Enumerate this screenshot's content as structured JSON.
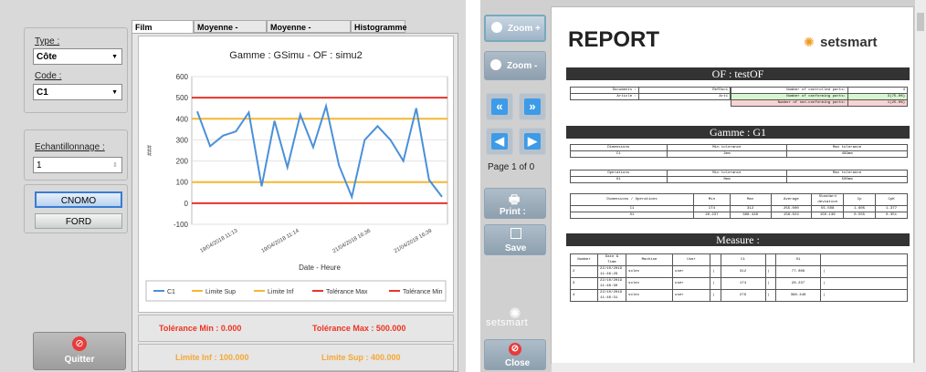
{
  "left": {
    "type_label": "Type :",
    "type_value": "Côte",
    "code_label": "Code :",
    "code_value": "C1",
    "sampling_label": "Echantillonnage :",
    "sampling_value": "1",
    "cnomo_button": "CNOMO",
    "ford_button": "FORD",
    "quit_button": "Quitter",
    "tabs": [
      "Film production",
      "Moyenne - Etendue",
      "Moyenne - EcartType",
      "Histogramme"
    ],
    "tol_min": "Tolérance Min :  0.000",
    "tol_max": "Tolérance Max :  500.000",
    "lim_inf": "Limite Inf :  100.000",
    "lim_sup": "Limite Sup :  400.000"
  },
  "chart_data": {
    "type": "line",
    "title": "Gamme : GSimu - OF : simu2",
    "xlabel": "Date - Heure",
    "ylabel": "###",
    "ylim": [
      -100,
      600
    ],
    "yticks": [
      -100,
      0,
      100,
      200,
      300,
      400,
      500,
      600
    ],
    "xtick_labels": [
      "19/04/2018 11:13",
      "19/04/2018 11:14",
      "21/04/2018 16:36",
      "21/04/2018 16:39"
    ],
    "series": [
      {
        "name": "C1",
        "color": "#4a90d9",
        "values": [
          435,
          270,
          320,
          340,
          430,
          80,
          390,
          170,
          420,
          265,
          460,
          180,
          30,
          300,
          365,
          300,
          200,
          450,
          110,
          30
        ]
      },
      {
        "name": "Limite Sup",
        "color": "#f6b630",
        "constant": 400
      },
      {
        "name": "Limite Inf",
        "color": "#f6b630",
        "constant": 100
      },
      {
        "name": "Tolérance Max",
        "color": "#e8332a",
        "constant": 500
      },
      {
        "name": "Tolérance Min",
        "color": "#e8332a",
        "constant": 0
      }
    ],
    "legend": "bottom",
    "grid": true
  },
  "right": {
    "zoom_in": "Zoom +",
    "zoom_out": "Zoom -",
    "page_info": "Page 1 of 0",
    "print_button": "Print :",
    "save_button": "Save",
    "close_button": "Close",
    "brand": "setsmart"
  },
  "report": {
    "title": "REPORT",
    "brand": "setsmart",
    "of_bar": "OF : testOF",
    "documents_label": "Documents :",
    "documents_value": "RefDoc1",
    "article_label": "Article :",
    "article_value": "Art1",
    "controlled_label": "Number of controlled parts:",
    "controlled_value": "4",
    "conforming_label": "Number of conforming parts:",
    "conforming_value": "3(75.0%)",
    "nonconforming_label": "Number of non-conforming parts:",
    "nonconforming_value": "1(25.0%)",
    "gamme_bar": "Gamme : G1",
    "dims_header": [
      "Dimensions",
      "Min tolerance",
      "Max tolerance"
    ],
    "dims_row": [
      "C1",
      "2mm",
      "499mm"
    ],
    "ops_header": [
      "Operations",
      "Min tolerance",
      "Max tolerance"
    ],
    "ops_row": [
      "O1",
      "0mm",
      "500mm"
    ],
    "stats_header": [
      "Dimensions / Operations",
      "Min",
      "Max",
      "Average",
      "Standard deviation",
      "Cp",
      "CpK"
    ],
    "stats_rows": [
      [
        "C1",
        "174",
        "312",
        "255.000",
        "55.508",
        "1.605",
        "1.377"
      ],
      [
        "O1",
        "28.237",
        "368.448",
        "158.024",
        "150.136",
        "0.555",
        "0.351"
      ]
    ],
    "measure_bar": "Measure :",
    "measure_header": [
      "Number",
      "Date & Time",
      "Machine",
      "User",
      "",
      "C1",
      "",
      "O1",
      ""
    ],
    "measure_rows": [
      [
        "2",
        "22/10/2019 11:46:29",
        "solex",
        "user",
        "|",
        "312",
        "|",
        "77.086",
        "|"
      ],
      [
        "3",
        "22/10/2019 11:46:30",
        "solex",
        "user",
        "|",
        "174",
        "|",
        "28.237",
        "|"
      ],
      [
        "4",
        "22/10/2019 11:46:31",
        "solex",
        "user",
        "|",
        "279",
        "|",
        "368.448",
        "|"
      ]
    ]
  }
}
